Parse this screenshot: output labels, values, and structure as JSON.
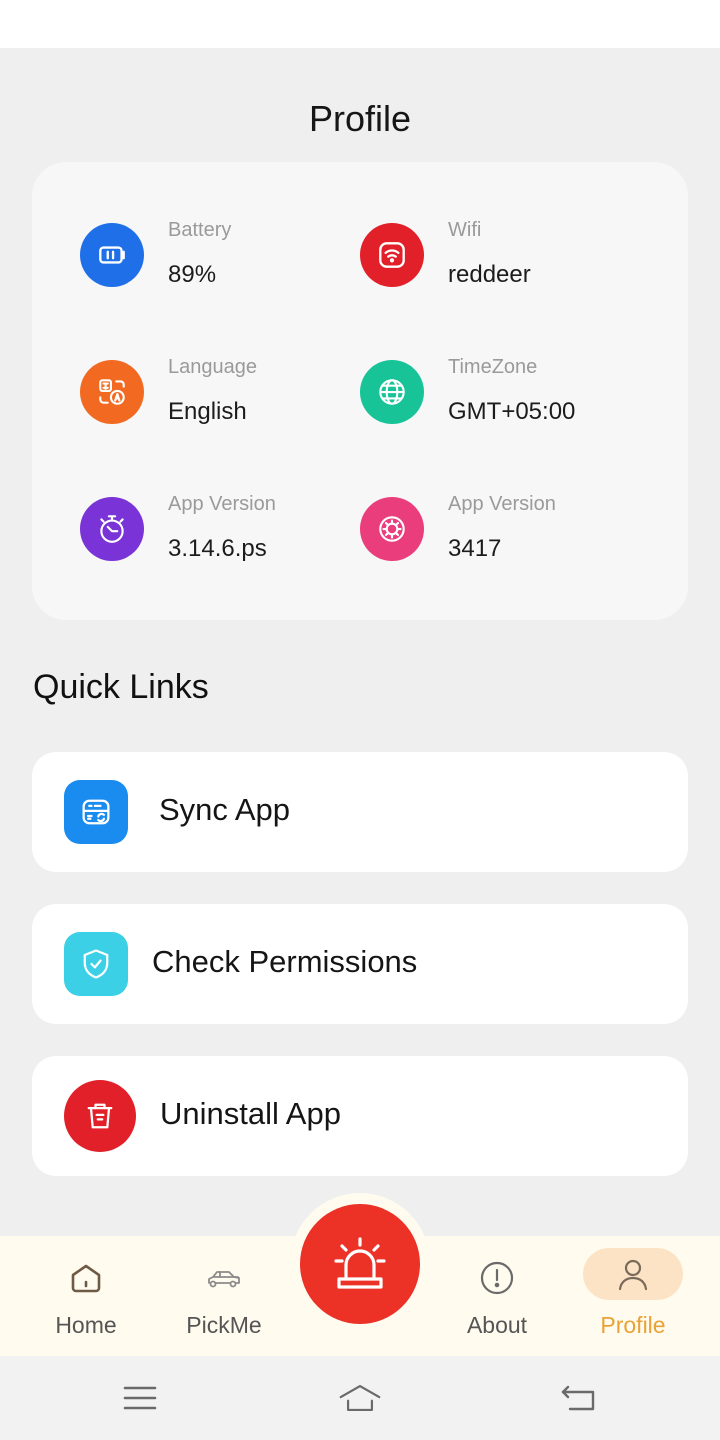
{
  "page": {
    "title": "Profile"
  },
  "info": [
    {
      "label": "Battery",
      "value": "89%",
      "icon": "battery-icon",
      "color": "#1f6fe8"
    },
    {
      "label": "Wifi",
      "value": "reddeer",
      "icon": "wifi-icon",
      "color": "#e1202a"
    },
    {
      "label": "Language",
      "value": "English",
      "icon": "translate-icon",
      "color": "#f26a21"
    },
    {
      "label": "TimeZone",
      "value": "GMT+05:00",
      "icon": "globe-icon",
      "color": "#17c397"
    },
    {
      "label": "App Version",
      "value": "3.14.6.ps",
      "icon": "stopwatch-icon",
      "color": "#7a33d6"
    },
    {
      "label": "App Version",
      "value": "3417",
      "icon": "gear-icon",
      "color": "#ea3e7c"
    }
  ],
  "quick_links": {
    "title": "Quick Links",
    "items": [
      {
        "label": "Sync App",
        "icon": "sync-icon",
        "color": "#1a8cf0"
      },
      {
        "label": "Check Permissions",
        "icon": "shield-check-icon",
        "color": "#3bd0e6"
      },
      {
        "label": "Uninstall App",
        "icon": "trash-icon",
        "color": "#e1202a"
      }
    ]
  },
  "nav": {
    "items": [
      {
        "label": "Home",
        "icon": "home-icon",
        "active": false
      },
      {
        "label": "PickMe",
        "icon": "car-icon",
        "active": false
      },
      {
        "label": "About",
        "icon": "info-icon",
        "active": false
      },
      {
        "label": "Profile",
        "icon": "user-icon",
        "active": true
      }
    ],
    "alarm_icon": "alarm-siren-icon",
    "active_color": "#e8a237"
  },
  "system_nav": {
    "icons": [
      "menu-icon",
      "home-outline-icon",
      "back-icon"
    ]
  }
}
